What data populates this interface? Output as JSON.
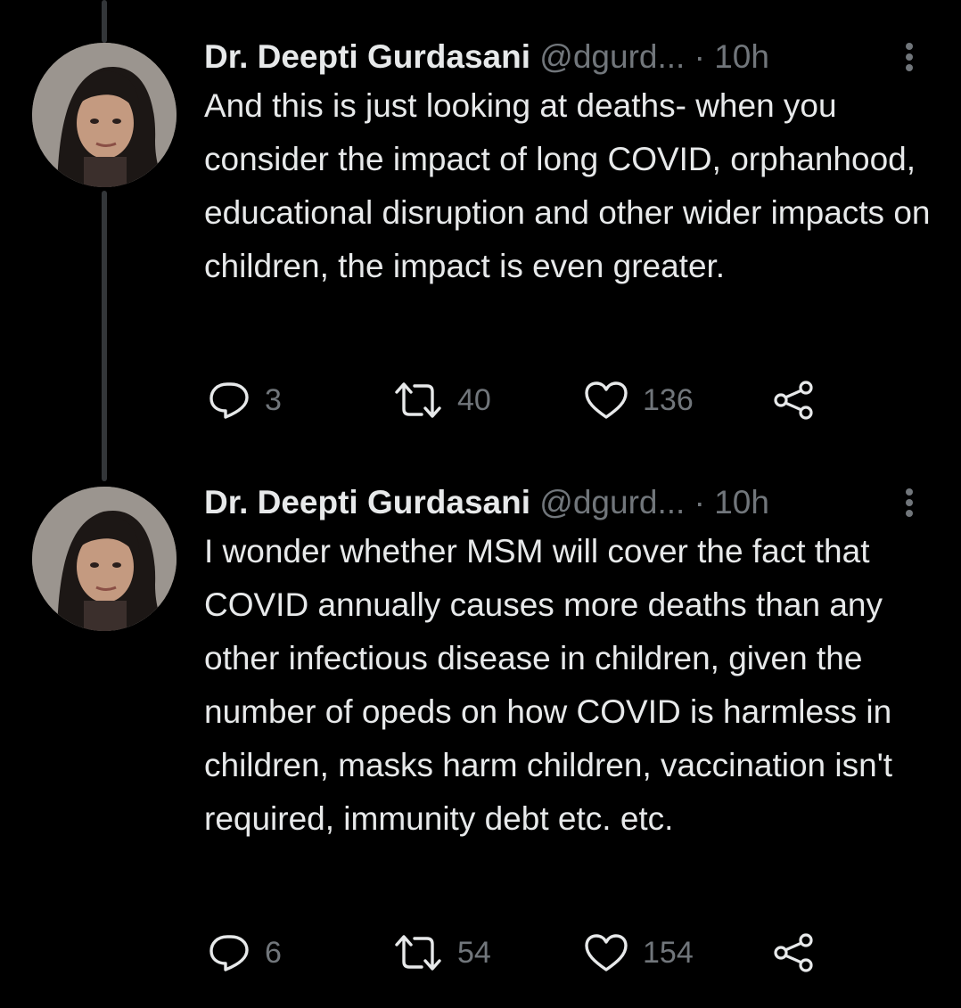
{
  "tweets": [
    {
      "display_name": "Dr. Deepti Gurdasani",
      "handle": "@dgurd...",
      "separator": "·",
      "time": "10h",
      "text": "And this is just looking at deaths- when you consider the impact of long COVID, orphanhood, educational disruption and other wider impacts on children, the impact is even greater.",
      "replies": "3",
      "retweets": "40",
      "likes": "136"
    },
    {
      "display_name": "Dr. Deepti Gurdasani",
      "handle": "@dgurd...",
      "separator": "·",
      "time": "10h",
      "text": "I wonder whether MSM will cover the fact that COVID annually causes more deaths than any other infectious disease in children, given the number of opeds on how COVID is harmless in children, masks harm children, vaccination isn't required, immunity debt etc. etc.",
      "replies": "6",
      "retweets": "54",
      "likes": "154"
    }
  ],
  "icons": {
    "reply": "reply-icon",
    "retweet": "retweet-icon",
    "like": "heart-icon",
    "share": "share-icon",
    "more": "more-vertical-icon"
  },
  "colors": {
    "background": "#000000",
    "text": "#e7e9ea",
    "secondary": "#71767b",
    "thread_line": "#333639"
  }
}
